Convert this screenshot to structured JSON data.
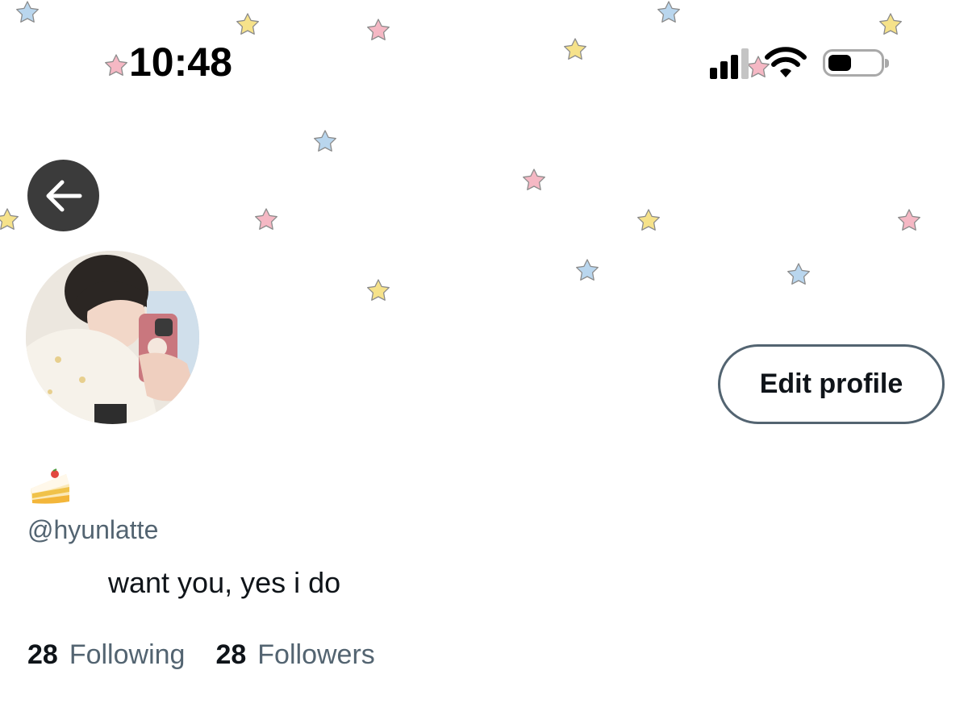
{
  "status_bar": {
    "time": "10:48"
  },
  "header": {
    "back_icon": "arrow-left-icon",
    "banner_decoration": "pastel-stars"
  },
  "profile": {
    "display_name_emoji": "shortcake",
    "handle": "@hyunlatte",
    "bio": "want you, yes i do",
    "edit_profile_label": "Edit profile",
    "following_count": "28",
    "following_label": "Following",
    "followers_count": "28",
    "followers_label": "Followers"
  },
  "colors": {
    "star_pink": "#f5b8c4",
    "star_yellow": "#f6e28a",
    "star_blue": "#b9d6ee",
    "secondary_text": "#536471",
    "back_button_bg": "#3b3b3b"
  }
}
